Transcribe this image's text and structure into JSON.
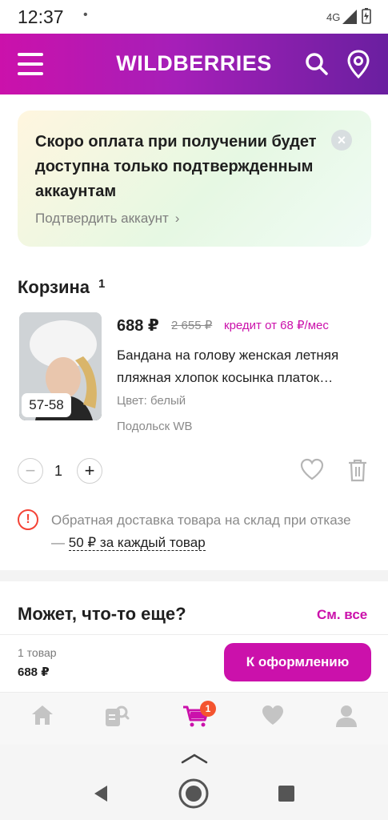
{
  "status": {
    "time": "12:37",
    "dot": "•",
    "network": "4G"
  },
  "header": {
    "brand": "WILDBERRIES"
  },
  "promo": {
    "text": "Скоро оплата при получении будет доступна только подтвержденным аккаунтам",
    "link": "Подтвердить аккаунт",
    "close": "×"
  },
  "cart": {
    "title": "Корзина",
    "count": "1"
  },
  "product": {
    "size": "57-58",
    "price": "688 ₽",
    "old_price": "2 655 ₽",
    "credit": "кредит от 68 ₽/мес",
    "name": "Бандана на голову женская летняя пляжная хлопок косынка платок…",
    "color": "Цвет: белый",
    "store": "Подольск WB",
    "quantity": "1",
    "minus": "−",
    "plus": "+"
  },
  "return_notice": {
    "icon_text": "!",
    "text": "Обратная доставка товара на склад при отказе — ",
    "link": "50 ₽ за каждый товар"
  },
  "more": {
    "title": "Может, что-то еще?",
    "see_all": "См. все"
  },
  "checkout": {
    "count": "1 товар",
    "total": "688 ₽",
    "button": "К оформлению"
  },
  "tabbar": {
    "cart_badge": "1",
    "active_tab": "cart"
  },
  "colors": {
    "brand": "#cb11ab",
    "brand_dark": "#6a1fa0",
    "badge": "#f4542f",
    "warning": "#f44336"
  },
  "icons": [
    "menu-icon",
    "search-icon",
    "location-icon",
    "close-icon",
    "chevron-right-icon",
    "heart-icon",
    "trash-icon",
    "warning-icon",
    "home-icon",
    "catalog-search-icon",
    "cart-icon",
    "favorites-icon",
    "profile-icon"
  ]
}
